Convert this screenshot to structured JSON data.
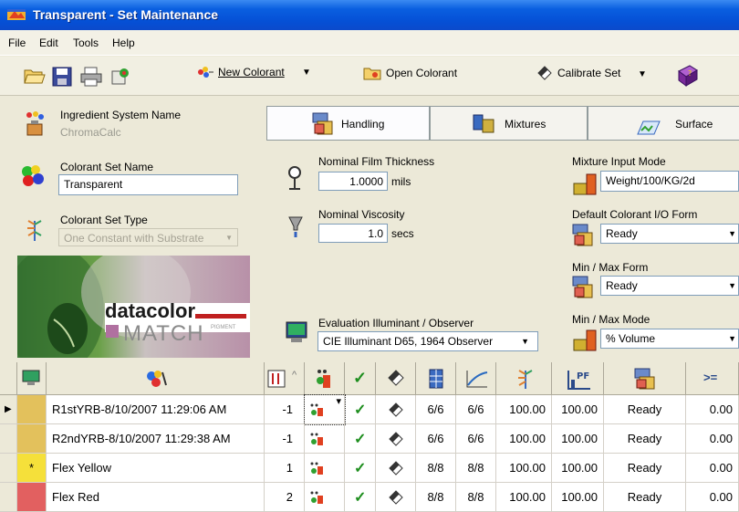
{
  "window": {
    "title": "Transparent - Set Maintenance"
  },
  "menu": [
    "File",
    "Edit",
    "Tools",
    "Help"
  ],
  "toolbar": {
    "new_colorant": "New Colorant",
    "open_colorant": "Open Colorant",
    "calibrate_set": "Calibrate Set"
  },
  "left": {
    "ingredient_label": "Ingredient System Name",
    "ingredient_value": "ChromaCalc",
    "set_name_label": "Colorant Set Name",
    "set_name_value": "Transparent",
    "set_type_label": "Colorant Set Type",
    "set_type_value": "One Constant with Substrate",
    "logo_top": "datacolor",
    "logo_bottom": "MATCH",
    "logo_small": "PIGMENT"
  },
  "tabs": [
    "Handling",
    "Mixtures",
    "Surface"
  ],
  "handling": {
    "film_label": "Nominal Film Thickness",
    "film_value": "1.0000",
    "film_unit": "mils",
    "visc_label": "Nominal Viscosity",
    "visc_value": "1.0",
    "visc_unit": "secs",
    "illum_label": "Evaluation Illuminant / Observer",
    "illum_value": "CIE Illuminant D65, 1964 Observer",
    "mix_mode_label": "Mixture Input Mode",
    "mix_mode_value": "Weight/100/KG/2d",
    "io_form_label": "Default Colorant I/O Form",
    "io_form_value": "Ready",
    "minmax_form_label": "Min / Max Form",
    "minmax_form_value": "Ready",
    "minmax_mode_label": "Min / Max Mode",
    "minmax_mode_value": "% Volume"
  },
  "grid": {
    "header_gt": ">=",
    "rows": [
      {
        "marker": "",
        "name": "R1stYRB-8/10/2007 11:29:06 AM",
        "num": "-1",
        "f1": "6/6",
        "f2": "6/6",
        "v1": "100.00",
        "v2": "100.00",
        "form": "Ready",
        "min": "0.00",
        "color": "#E3C15C"
      },
      {
        "marker": "",
        "name": "R2ndYRB-8/10/2007 11:29:38 AM",
        "num": "-1",
        "f1": "6/6",
        "f2": "6/6",
        "v1": "100.00",
        "v2": "100.00",
        "form": "Ready",
        "min": "0.00",
        "color": "#E3C15C"
      },
      {
        "marker": "*",
        "name": "Flex Yellow",
        "num": "1",
        "f1": "8/8",
        "f2": "8/8",
        "v1": "100.00",
        "v2": "100.00",
        "form": "Ready",
        "min": "0.00",
        "color": "#F5E03A"
      },
      {
        "marker": "",
        "name": "Flex Red",
        "num": "2",
        "f1": "8/8",
        "f2": "8/8",
        "v1": "100.00",
        "v2": "100.00",
        "form": "Ready",
        "min": "0.00",
        "color": "#E26060"
      }
    ]
  }
}
